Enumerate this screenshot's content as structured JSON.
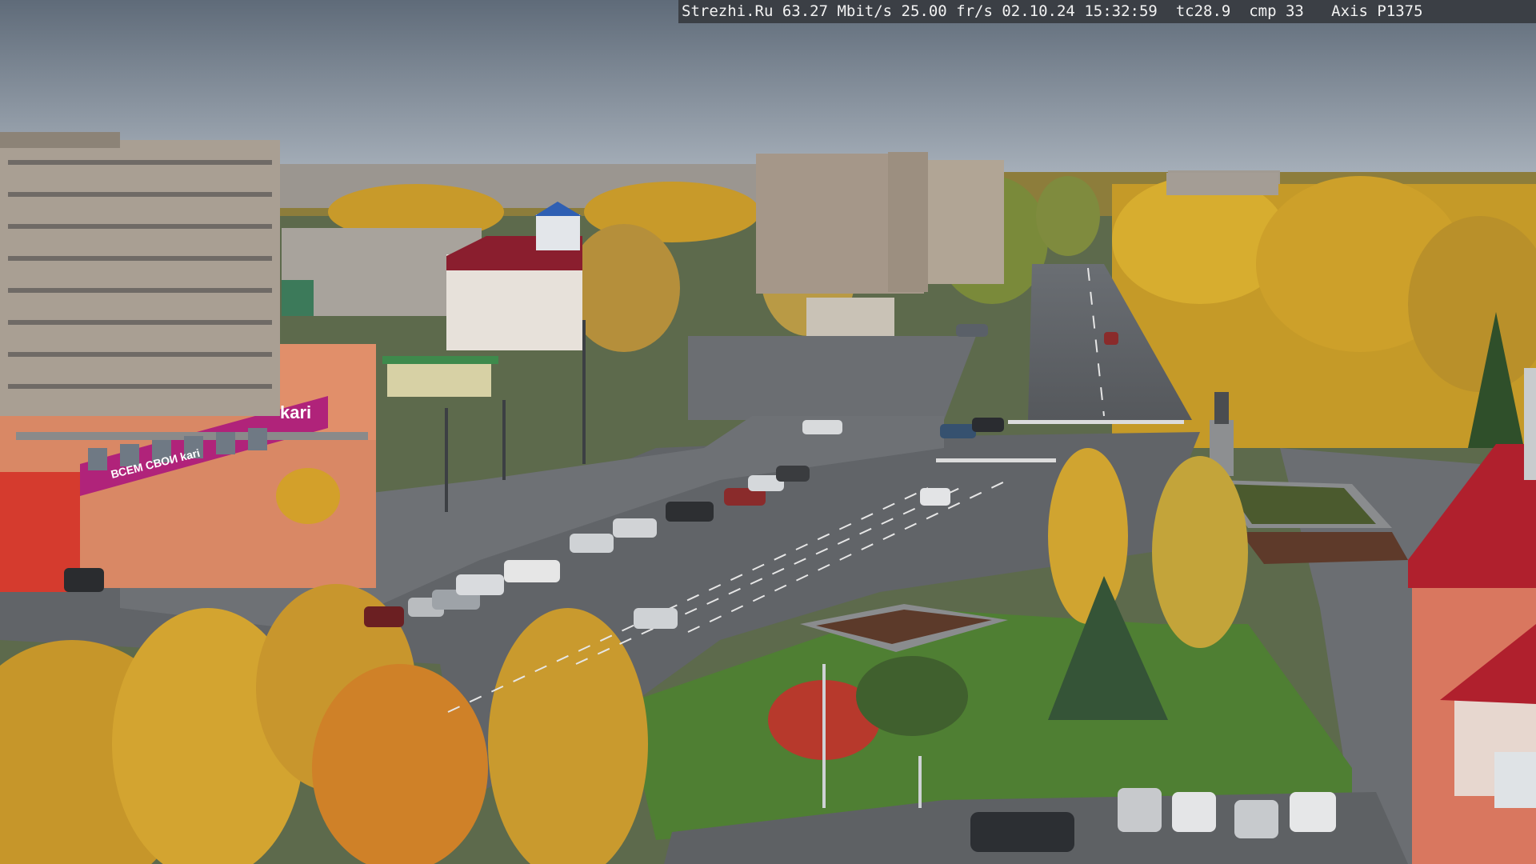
{
  "overlay": {
    "text": "Strezhi.Ru 63.27 Mbit/s 25.00 fr/s 02.10.24 15:32:59  tc28.9  cmp 33   Axis P1375"
  },
  "signs": {
    "store_brand": "kari",
    "store_banner": "ВСЕМ СВОИ kari"
  },
  "colors": {
    "sky": "#7e8a98",
    "asphalt": "#5f6368",
    "grass": "#4f7a35",
    "autumn_foliage": "#d6a526",
    "store_banner": "#b0237a",
    "roof_red": "#b0202d"
  }
}
